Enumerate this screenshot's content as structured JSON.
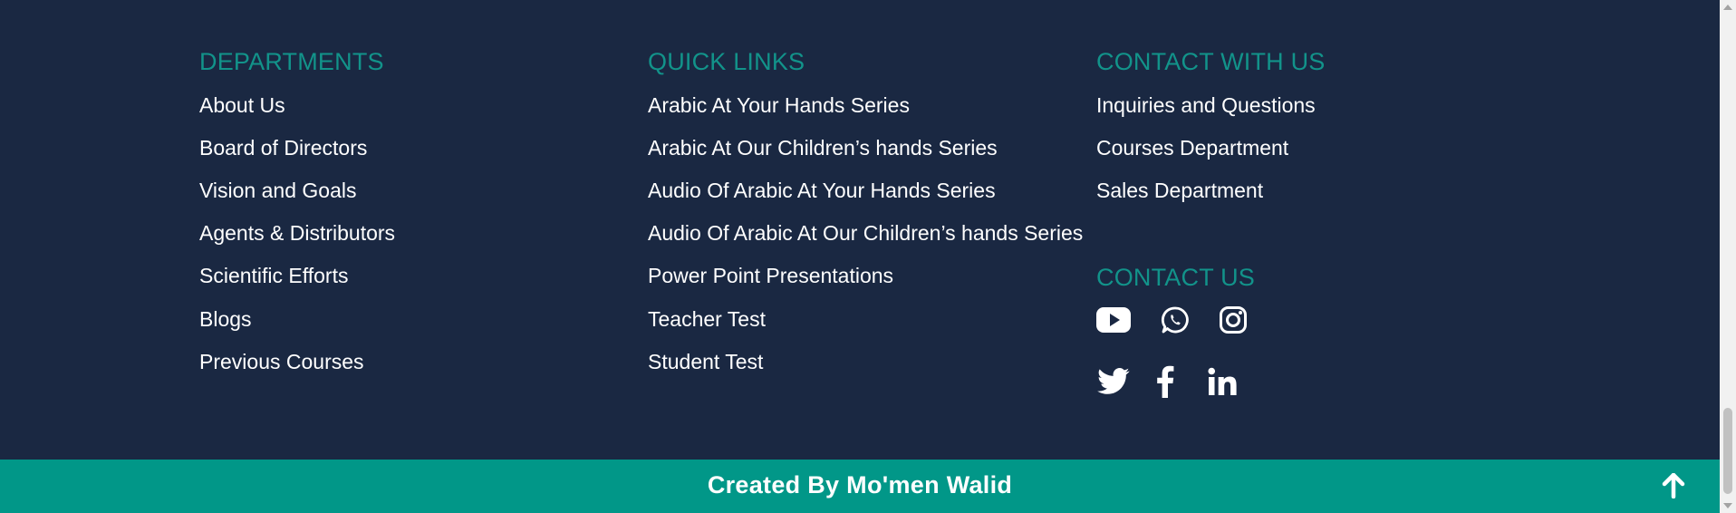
{
  "departments": {
    "heading": "DEPARTMENTS",
    "links": [
      "About Us",
      "Board of Directors",
      "Vision and Goals",
      "Agents & Distributors",
      "Scientific Efforts",
      "Blogs",
      "Previous Courses"
    ]
  },
  "quick_links": {
    "heading": "QUICK LINKS",
    "links": [
      "Arabic At Your Hands Series",
      "Arabic At Our Children’s hands Series",
      "Audio Of Arabic At Your Hands Series",
      "Audio Of Arabic At Our Children’s hands Series",
      "Power Point Presentations",
      "Teacher Test",
      "Student Test"
    ]
  },
  "contact_with_us": {
    "heading": "CONTACT WITH US",
    "links": [
      "Inquiries and Questions",
      "Courses Department",
      "Sales Department"
    ]
  },
  "contact_us": {
    "heading": "CONTACT US",
    "socials": [
      "youtube-icon",
      "whatsapp-icon",
      "instagram-icon",
      "twitter-icon",
      "facebook-icon",
      "linkedin-icon"
    ]
  },
  "footer": {
    "credit": "Created By Mo'men Walid",
    "scroll_top_icon": "arrow-up-icon"
  },
  "colors": {
    "background": "#1a2842",
    "heading": "#12938a",
    "link": "#ffffff",
    "bottom_bar": "#019788"
  }
}
